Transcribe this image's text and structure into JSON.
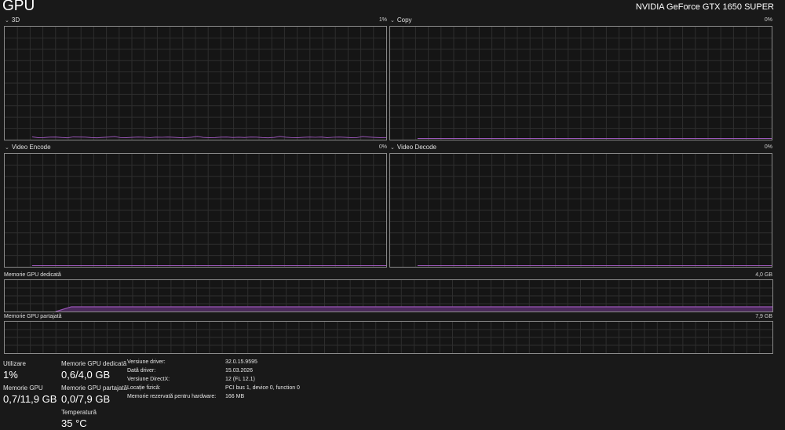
{
  "header": {
    "title": "GPU",
    "device": "NVIDIA GeForce GTX 1650 SUPER"
  },
  "engines": [
    {
      "label": "3D",
      "percent": "1%",
      "utilization": 0.01
    },
    {
      "label": "Copy",
      "percent": "0%",
      "utilization": 0
    },
    {
      "label": "Video Encode",
      "percent": "0%",
      "utilization": 0
    },
    {
      "label": "Video Decode",
      "percent": "0%",
      "utilization": 0
    }
  ],
  "memory_graphs": {
    "dedicated": {
      "label": "Memorie GPU dedicată",
      "max": "4,0 GB",
      "used_gb": 0.6,
      "total_gb": 4.0
    },
    "shared": {
      "label": "Memorie GPU partajată",
      "max": "7,9 GB",
      "used_gb": 0.0,
      "total_gb": 7.9
    }
  },
  "stats": {
    "utilization": {
      "label": "Utilizare",
      "value": "1%"
    },
    "gpu_memory": {
      "label": "Memorie GPU",
      "value": "0,7/11,9 GB"
    },
    "dedicated": {
      "label": "Memorie GPU dedicată",
      "value": "0,6/4,0 GB"
    },
    "shared": {
      "label": "Memorie GPU partajată",
      "value": "0,0/7,9 GB"
    },
    "temperature": {
      "label": "Temperatură",
      "value": "35 °C"
    }
  },
  "info": [
    {
      "key": "Versiune driver:",
      "value": "32.0.15.9595"
    },
    {
      "key": "Dată driver:",
      "value": "15.03.2026"
    },
    {
      "key": "Versiune DirectX:",
      "value": "12 (FL 12.1)"
    },
    {
      "key": "Locație fizică:",
      "value": "PCI bus 1, device 0, function 0"
    },
    {
      "key": "Memorie rezervată pentru hardware:",
      "value": "166 MB"
    }
  ],
  "colors": {
    "line": "#9a56b8",
    "fill": "#4a2a5a",
    "grid": "#2e2e2e",
    "border": "#8a8a8a"
  }
}
